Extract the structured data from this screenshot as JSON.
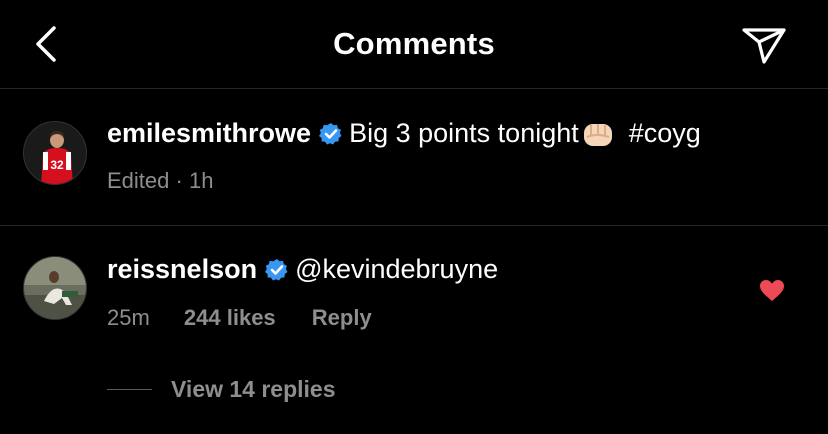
{
  "header": {
    "title": "Comments",
    "back_icon": "chevron-left-icon",
    "share_icon": "paper-plane-icon"
  },
  "caption": {
    "username": "emilesmithrowe",
    "text": "Big 3 points tonight",
    "hashtag": "#coyg",
    "edited": "Edited",
    "separator": "·",
    "time": "1h",
    "jersey_number": "32"
  },
  "comment": {
    "username": "reissnelson",
    "text": "@kevindebruyne",
    "time": "25m",
    "likes": "244 likes",
    "reply": "Reply",
    "liked": true
  },
  "replies": {
    "label": "View 14 replies"
  },
  "colors": {
    "background": "#000000",
    "verified": "#3897f0",
    "heart": "#ed4956",
    "muted": "#8e8e8e"
  }
}
